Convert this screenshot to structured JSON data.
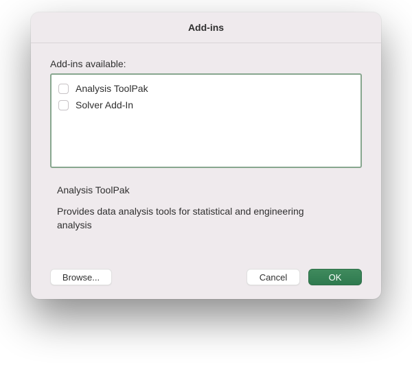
{
  "dialog": {
    "title": "Add-ins",
    "section_label": "Add-ins available:",
    "items": [
      {
        "label": "Analysis ToolPak",
        "checked": false
      },
      {
        "label": "Solver Add-In",
        "checked": false
      }
    ],
    "selected_title": "Analysis ToolPak",
    "selected_description": "Provides data analysis tools for statistical and engineering analysis",
    "buttons": {
      "browse": "Browse...",
      "cancel": "Cancel",
      "ok": "OK"
    }
  }
}
